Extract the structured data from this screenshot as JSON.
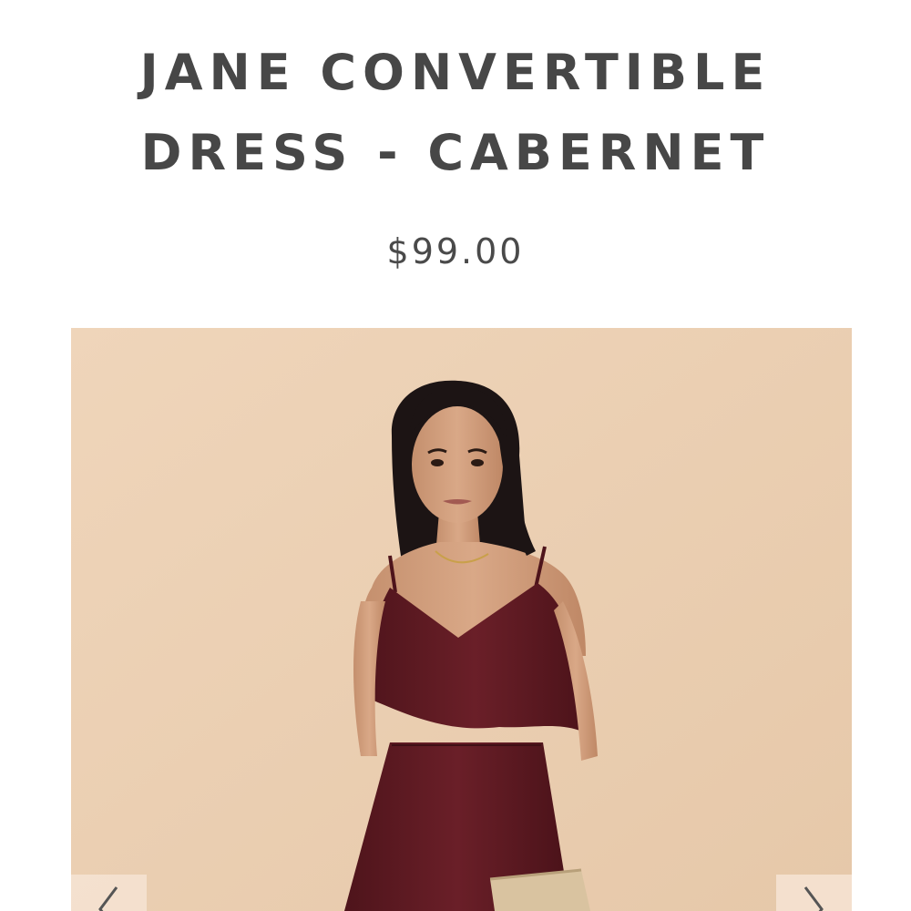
{
  "product": {
    "title_line1": "JANE CONVERTIBLE",
    "title_line2": "DRESS - CABERNET",
    "price": "$99.00"
  },
  "gallery": {
    "image": "product-photo-model-in-cabernet-dress",
    "prev_icon": "chevron-left-icon",
    "next_icon": "chevron-right-icon"
  },
  "colors": {
    "title_text": "#474747",
    "price_text": "#4a4a4a",
    "photo_background": "#ecd1b5",
    "dress": "#5e1a22",
    "nav_button_bg": "#f5e2d2"
  }
}
